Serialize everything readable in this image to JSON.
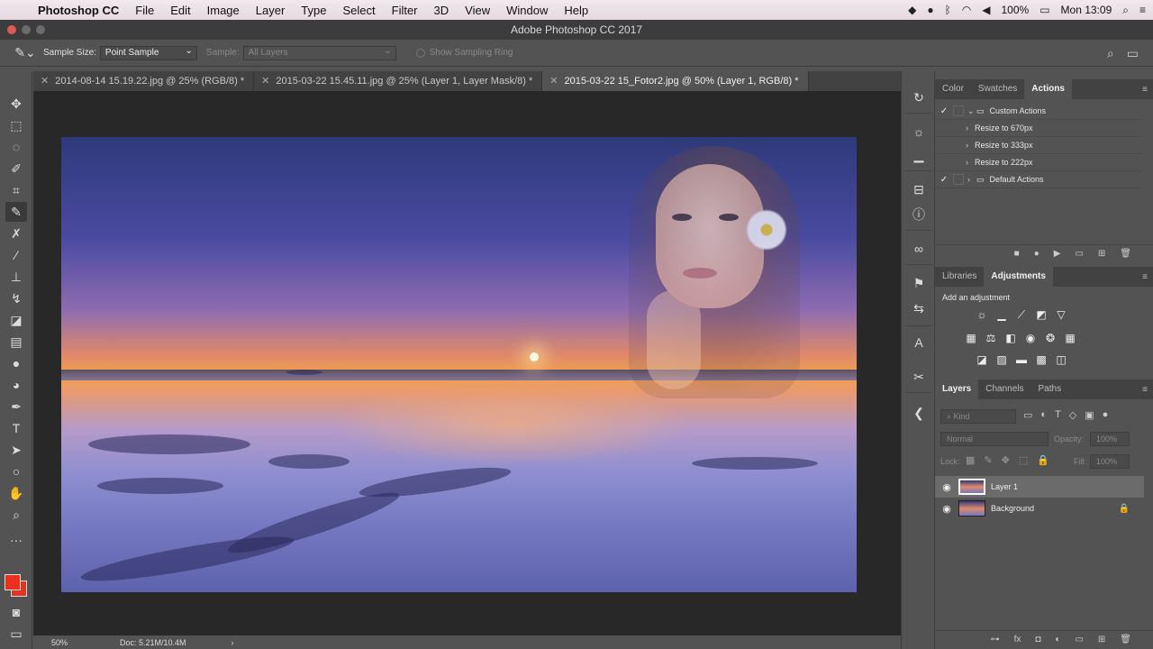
{
  "menubar": {
    "app_name": "Photoshop CC",
    "items": [
      "File",
      "Edit",
      "Image",
      "Layer",
      "Type",
      "Select",
      "Filter",
      "3D",
      "View",
      "Window",
      "Help"
    ],
    "battery": "100%",
    "clock": "Mon 13:09"
  },
  "window": {
    "title": "Adobe Photoshop CC 2017"
  },
  "options_bar": {
    "sample_size_label": "Sample Size:",
    "sample_size_value": "Point Sample",
    "sample_label": "Sample:",
    "sample_value": "All Layers",
    "show_ring_label": "Show Sampling Ring"
  },
  "doc_tabs": [
    {
      "label": "2014-08-14 15.19.22.jpg @ 25% (RGB/8) *",
      "active": false
    },
    {
      "label": "2015-03-22 15.45.11.jpg @ 25% (Layer 1, Layer Mask/8) *",
      "active": false
    },
    {
      "label": "2015-03-22 15_Fotor2.jpg @ 50% (Layer 1, RGB/8) *",
      "active": true
    }
  ],
  "status": {
    "zoom": "50%",
    "doc": "Doc: 5.21M/10.4M"
  },
  "panel_color_tabs": {
    "color": "Color",
    "swatches": "Swatches",
    "actions": "Actions"
  },
  "actions": [
    {
      "label": "Custom Actions",
      "level": 0,
      "folder": true
    },
    {
      "label": "Resize to 670px",
      "level": 1
    },
    {
      "label": "Resize to 333px",
      "level": 1
    },
    {
      "label": "Resize to 222px",
      "level": 1
    },
    {
      "label": "Default Actions",
      "level": 0,
      "folder": true
    }
  ],
  "panel_adj_tabs": {
    "libraries": "Libraries",
    "adjustments": "Adjustments"
  },
  "adjustments": {
    "title": "Add an adjustment"
  },
  "panel_layers_tabs": {
    "layers": "Layers",
    "channels": "Channels",
    "paths": "Paths"
  },
  "layers_panel": {
    "kind_placeholder": "Kind",
    "blend_mode": "Normal",
    "opacity_label": "Opacity:",
    "opacity_value": "100%",
    "lock_label": "Lock:",
    "fill_label": "Fill:",
    "fill_value": "100%",
    "layers": [
      {
        "name": "Layer 1",
        "selected": true
      },
      {
        "name": "Background",
        "selected": false,
        "locked": true
      }
    ]
  },
  "colors": {
    "foreground": "#e8321e",
    "background": "#e8321e",
    "accent": "#535353"
  }
}
